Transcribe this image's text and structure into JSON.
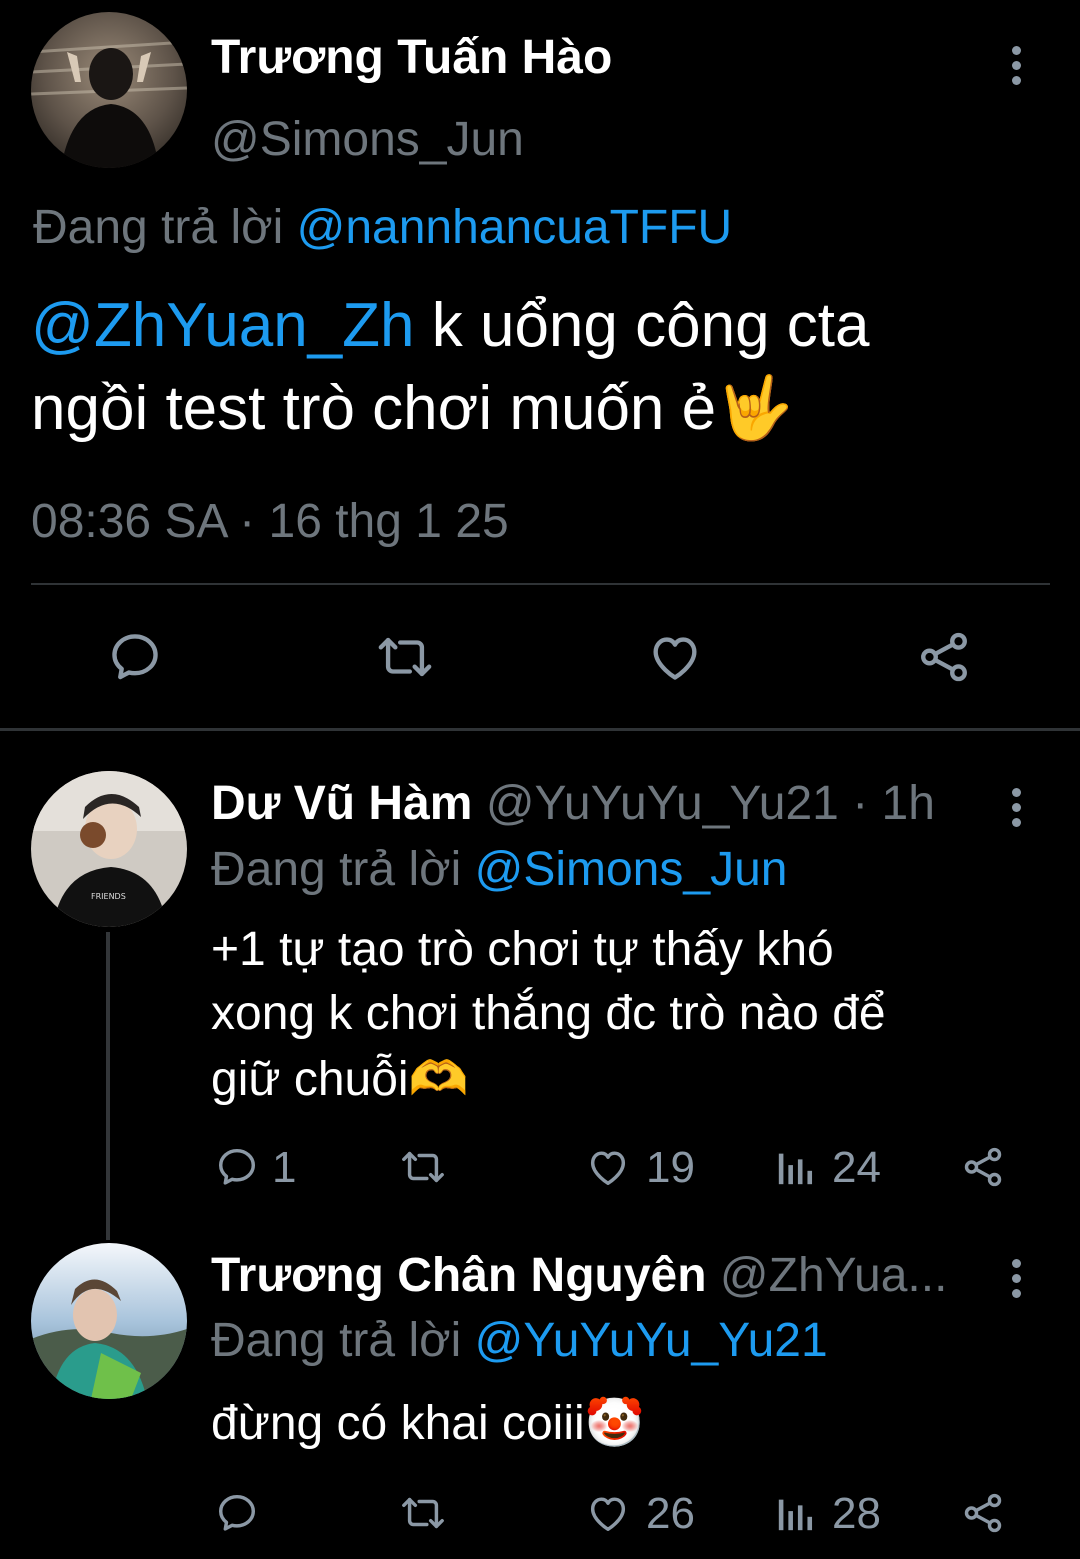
{
  "main_tweet": {
    "display_name": "Trương Tuấn Hào",
    "handle": "@Simons_Jun",
    "replying_prefix": "Đang trả lời",
    "replying_to": "@nannhancuaTFFU",
    "mention": "@ZhYuan_Zh",
    "text_line1": " k uổng công cta",
    "text_line2": "ngồi test trò chơi muốn ẻ🤟",
    "timestamp": "08:36 SA · 16 thg 1 25"
  },
  "replies": [
    {
      "display_name": "Dư Vũ Hàm",
      "handle": "@YuYuYu_Yu21",
      "time": "· 1h",
      "replying_prefix": "Đang trả lời",
      "replying_to": "@Simons_Jun",
      "text_line1": "+1 tự tạo trò chơi tự thấy khó",
      "text_line2": "xong k chơi thắng đc trò nào để",
      "text_line3": "giữ chuỗi🫶",
      "reply_count": "1",
      "like_count": "19",
      "view_count": "24"
    },
    {
      "display_name": "Trương Chân Nguyên",
      "handle": "@ZhYua...",
      "replying_prefix": "Đang trả lời",
      "replying_to": "@YuYuYu_Yu21",
      "text_line1": "đừng có khai coiii🤡",
      "like_count": "26",
      "view_count": "28"
    }
  ],
  "colors": {
    "background": "#000000",
    "text": "#e7e9ea",
    "muted": "#6e767d",
    "link": "#1d9bf0",
    "icon": "#8b98a5",
    "divider": "#2f3336"
  },
  "icons": [
    "more-vertical-icon",
    "reply-icon",
    "retweet-icon",
    "like-icon",
    "share-icon",
    "views-icon"
  ]
}
